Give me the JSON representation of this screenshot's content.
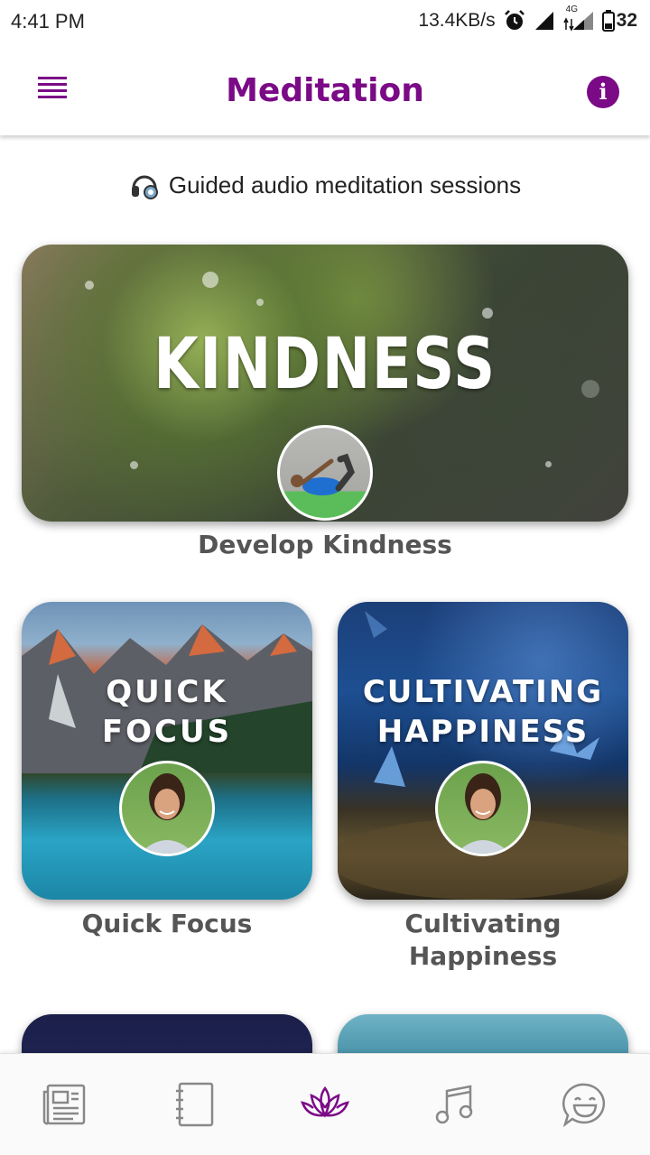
{
  "status_bar": {
    "time": "4:41 PM",
    "network_speed": "13.4KB/s",
    "network_type": "4G",
    "battery": "32",
    "icons": [
      "alarm-icon",
      "signal-icon",
      "signal-4g-icon",
      "battery-icon"
    ]
  },
  "app_bar": {
    "title": "Meditation",
    "menu_icon": "menu-icon",
    "info_icon": "info-icon",
    "info_glyph": "i",
    "accent_color": "#7b0a87"
  },
  "subtitle": {
    "icon": "headphones-icon",
    "text": "Guided audio meditation sessions"
  },
  "sessions": [
    {
      "banner": "KINDNESS",
      "label": "Develop Kindness"
    },
    {
      "banner": "QUICK FOCUS",
      "banner_line1": "QUICK",
      "banner_line2": "FOCUS",
      "label": "Quick Focus"
    },
    {
      "banner": "CULTIVATING HAPPINESS",
      "banner_line1": "CULTIVATING",
      "banner_line2": "HAPPINESS",
      "label_line1": "Cultivating",
      "label_line2": "Happiness"
    }
  ],
  "bottom_nav": [
    {
      "name": "news",
      "icon": "newspaper-icon"
    },
    {
      "name": "journal",
      "icon": "notebook-icon"
    },
    {
      "name": "meditation",
      "icon": "lotus-icon",
      "active": true
    },
    {
      "name": "music",
      "icon": "music-note-icon"
    },
    {
      "name": "chat",
      "icon": "smiley-chat-icon"
    }
  ]
}
